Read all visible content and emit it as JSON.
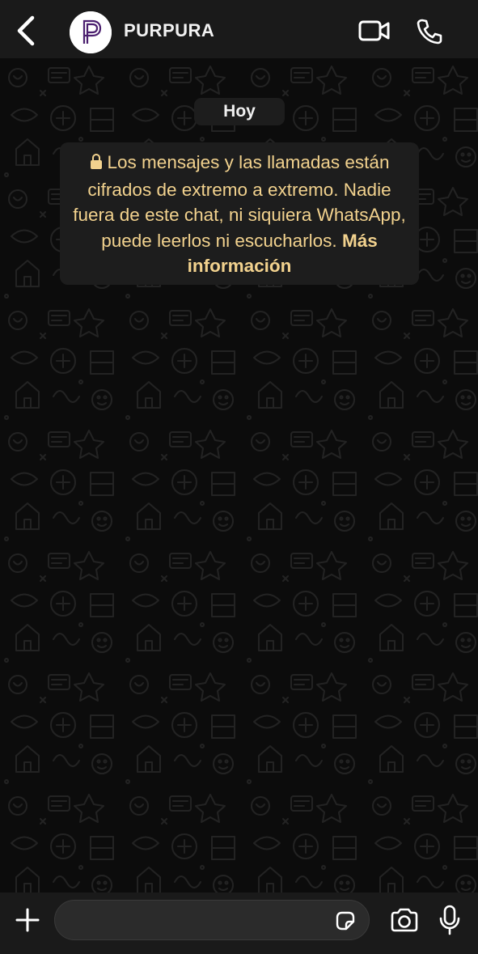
{
  "header": {
    "contact_name": "PURPURA",
    "avatar_letter": "P",
    "icons": {
      "back": "chevron-left-icon",
      "video": "video-camera-icon",
      "call": "phone-icon"
    }
  },
  "chat": {
    "date_label": "Hoy",
    "encryption_notice": {
      "text": "Los mensajes y las llamadas están cifrados de extremo a extremo. Nadie fuera de este chat, ni siquiera WhatsApp, puede leerlos ni escucharlos.",
      "link_text": "Más información",
      "icon": "lock-icon"
    }
  },
  "composer": {
    "input_value": "",
    "input_placeholder": "",
    "icons": {
      "attach": "plus-icon",
      "sticker": "sticker-icon",
      "camera": "camera-icon",
      "mic": "microphone-icon"
    }
  },
  "colors": {
    "header_bg": "#1a1a1a",
    "wallpaper_bg": "#0c0c0c",
    "bubble_bg": "#1d1d1d",
    "notice_text": "#f2d28e",
    "avatar_accent": "#4b1f6f",
    "icon_color": "#ffffff"
  }
}
